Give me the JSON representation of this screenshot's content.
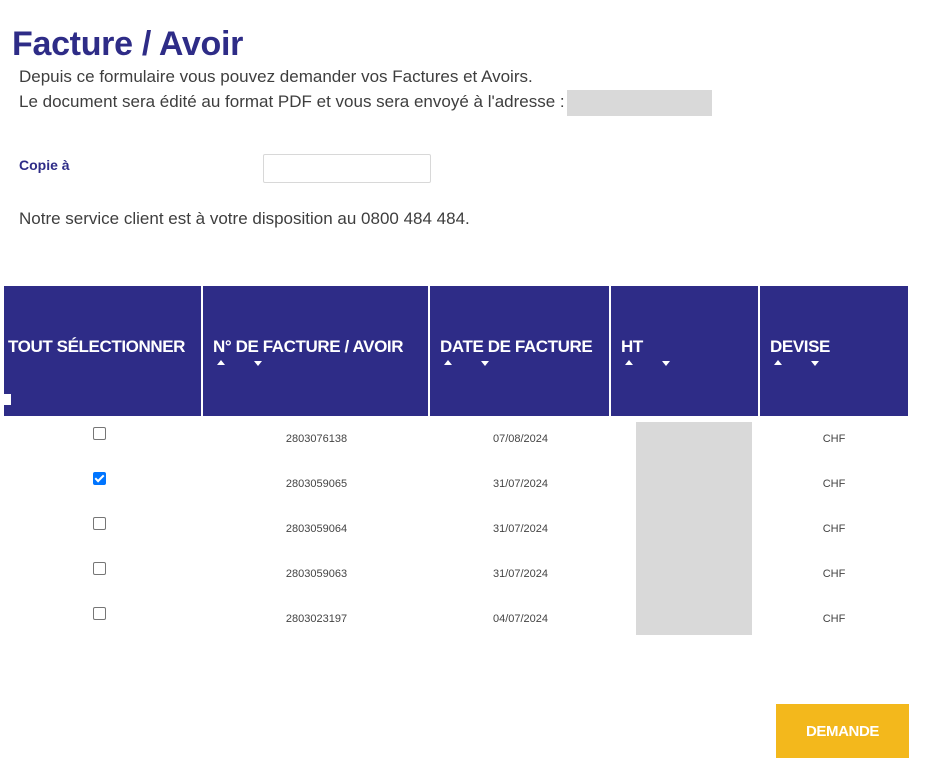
{
  "page": {
    "title": "Facture / Avoir",
    "intro_line1": "Depuis ce formulaire vous pouvez demander vos Factures et Avoirs.",
    "intro_line2": "Le document sera édité au format PDF et vous sera envoyé à l'adresse :",
    "support_text": "Notre service client est à votre disposition au 0800 484 484."
  },
  "form": {
    "copie_label": "Copie à",
    "copie_value": ""
  },
  "table": {
    "columns": [
      {
        "label": "TOUT SÉLECTIONNER",
        "sortable": false
      },
      {
        "label": "N° DE FACTURE / AVOIR",
        "sortable": true
      },
      {
        "label": "DATE DE FACTURE",
        "sortable": true
      },
      {
        "label": "HT",
        "sortable": true
      },
      {
        "label": "DEVISE",
        "sortable": true
      }
    ],
    "rows": [
      {
        "checked": false,
        "number": "2803076138",
        "date": "07/08/2024",
        "devise": "CHF"
      },
      {
        "checked": true,
        "number": "2803059065",
        "date": "31/07/2024",
        "devise": "CHF"
      },
      {
        "checked": false,
        "number": "2803059064",
        "date": "31/07/2024",
        "devise": "CHF"
      },
      {
        "checked": false,
        "number": "2803059063",
        "date": "31/07/2024",
        "devise": "CHF"
      },
      {
        "checked": false,
        "number": "2803023197",
        "date": "04/07/2024",
        "devise": "CHF"
      }
    ]
  },
  "actions": {
    "submit_label": "DEMANDE"
  },
  "colors": {
    "brand_navy": "#2e2c87",
    "accent_yellow": "#f3b81c",
    "checkbox_blue": "#0075ff",
    "redaction_gray": "#d9d9d9"
  }
}
